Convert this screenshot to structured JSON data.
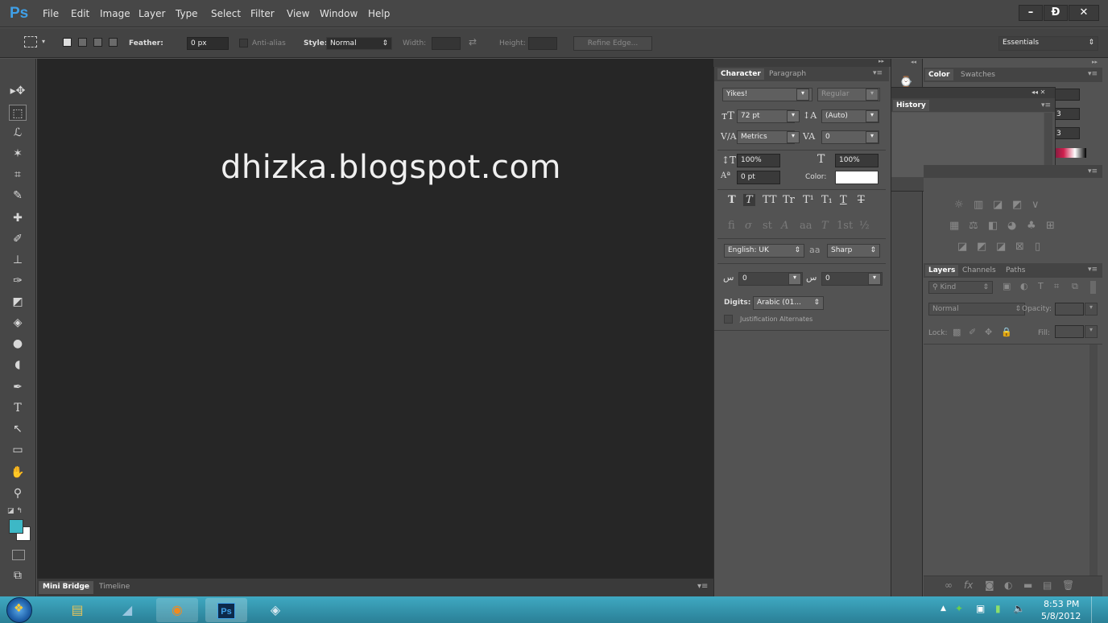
{
  "app": {
    "logo": "Ps"
  },
  "menu": [
    "File",
    "Edit",
    "Image",
    "Layer",
    "Type",
    "Select",
    "Filter",
    "View",
    "Window",
    "Help"
  ],
  "window_controls": {
    "minimize": "–",
    "restore": "Ɖ",
    "close": "✕"
  },
  "options_bar": {
    "feather_label": "Feather:",
    "feather_value": "0 px",
    "antialias_label": "Anti-alias",
    "style_label": "Style:",
    "style_value": "Normal",
    "width_label": "Width:",
    "height_label": "Height:",
    "refine_edge": "Refine Edge...",
    "workspace": "Essentials"
  },
  "canvas": {
    "text": "dhizka.blogspot.com"
  },
  "bottom_tabs": {
    "mini_bridge": "Mini Bridge",
    "timeline": "Timeline"
  },
  "character_panel": {
    "tab_character": "Character",
    "tab_paragraph": "Paragraph",
    "font_family": "Yikes!",
    "font_style": "Regular",
    "font_size": "72 pt",
    "leading": "(Auto)",
    "kerning": "Metrics",
    "tracking": "0",
    "vertical_scale": "100%",
    "horizontal_scale": "100%",
    "baseline_shift": "0 pt",
    "color_label": "Color:",
    "language": "English: UK",
    "aa_label": "a",
    "antialias": "Sharp",
    "kashida_1": "0",
    "kashida_2": "0",
    "digits_label": "Digits:",
    "digits_value": "Arabic (01...",
    "justification_alternates": "Justification Alternates"
  },
  "color_panel": {
    "tab_color": "Color",
    "tab_swatches": "Swatches",
    "value_1": "3",
    "value_2": "3"
  },
  "history_panel": {
    "title": "History"
  },
  "layers_panel": {
    "tab_layers": "Layers",
    "tab_channels": "Channels",
    "tab_paths": "Paths",
    "kind_label": "Kind",
    "blend_mode": "Normal",
    "opacity_label": "Opacity:",
    "lock_label": "Lock:",
    "fill_label": "Fill:"
  },
  "taskbar": {
    "clock_time": "8:53 PM",
    "clock_date": "5/8/2012",
    "ps_label": "Ps"
  },
  "colors": {
    "foreground": "#3db8c6",
    "background": "#ffffff",
    "canvas_bg": "#262626",
    "ps_blue": "#3fa0e8"
  }
}
